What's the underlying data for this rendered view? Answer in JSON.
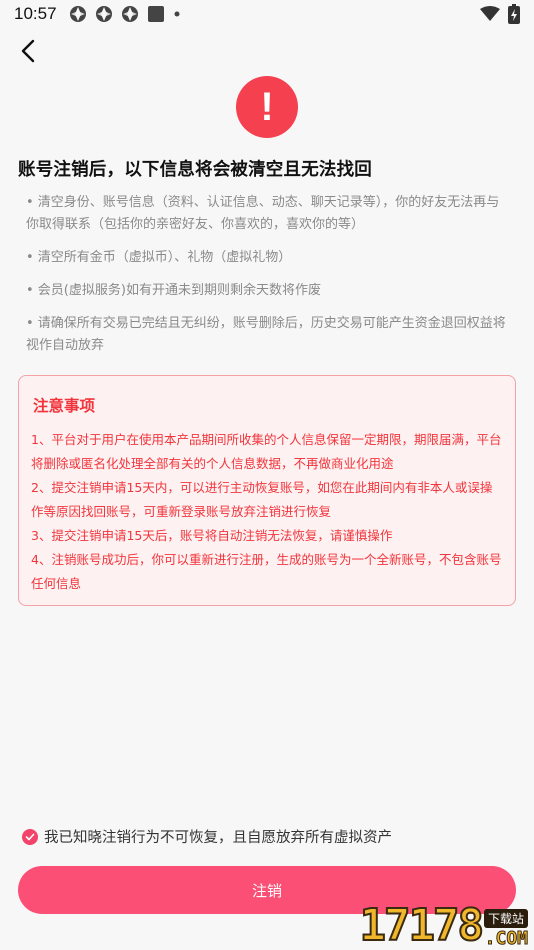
{
  "status_bar": {
    "time": "10:57",
    "icons": [
      "app-icon",
      "app-icon",
      "app-icon",
      "app-icon",
      "dot-icon"
    ],
    "right_icons": [
      "wifi-icon",
      "battery-icon"
    ]
  },
  "header": {
    "back_icon": "chevron-left-icon"
  },
  "warning": {
    "symbol": "!",
    "color": "#f4404f"
  },
  "headline": "账号注销后，以下信息将会被清空且无法找回",
  "info_items": [
    "• 清空身份、账号信息（资料、认证信息、动态、聊天记录等），你的好友无法再与你取得联系（包括你的亲密好友、你喜欢的，喜欢你的等）",
    "• 清空所有金币（虚拟币）、礼物（虚拟礼物）",
    "• 会员(虚拟服务)如有开通未到期则剩余天数将作废",
    "• 请确保所有交易已完结且无纠纷，账号删除后，历史交易可能产生资金退回权益将视作自动放弃"
  ],
  "notice": {
    "title": "注意事项",
    "items": [
      "1、平台对于用户在使用本产品期间所收集的个人信息保留一定期限，期限届满，平台将删除或匿名化处理全部有关的个人信息数据，不再做商业化用途",
      "2、提交注销申请15天内，可以进行主动恢复账号，如您在此期间内有非本人或误操作等原因找回账号，可重新登录账号放弃注销进行恢复",
      "3、提交注销申请15天后，账号将自动注销无法恢复，请谨慎操作",
      "4、注销账号成功后，你可以重新进行注册，生成的账号为一个全新账号，不包含账号任何信息"
    ],
    "color": "#f2353c"
  },
  "agreement": {
    "checked": true,
    "text": "我已知晓注销行为不可恢复，且自愿放弃所有虚拟资产"
  },
  "button": {
    "label": "注销",
    "color": "#fb4f76"
  },
  "watermark": {
    "logo": "17178",
    "sub": "下载站",
    "domain": ".COM"
  }
}
